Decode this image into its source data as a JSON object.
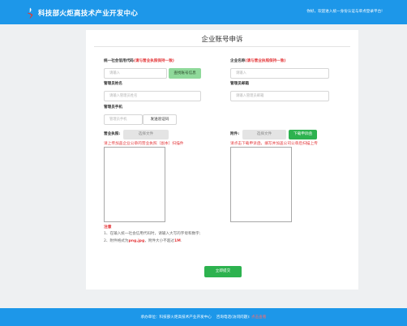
{
  "header": {
    "site_title": "科技部火炬高技术产业开发中心",
    "welcome": "你好，欢迎进入统一身份认证与单点登录平台!",
    "brand_color": "#1d97e9"
  },
  "page_title": "企业账号申诉",
  "form": {
    "credit_code": {
      "label": "统一社会信用代码",
      "req": "(请与营业执照保持一致)",
      "placeholder": "请输入",
      "query_button": "查找账号信息"
    },
    "company_name": {
      "label": "企业名称",
      "req": "(请与营业执照保持一致)",
      "placeholder": "请输入"
    },
    "admin_name": {
      "label": "管理员姓名",
      "placeholder": "请输入管理员姓名"
    },
    "admin_email": {
      "label": "管理员邮箱",
      "placeholder": "请输入管理员邮箱"
    },
    "admin_phone": {
      "label": "管理员手机",
      "placeholder": "管理员手机",
      "code_button": "发送验证码"
    },
    "business_license": {
      "label": "营业执照:",
      "choose_button": "选择文件",
      "hint": "请上传加盖企业公章的营业执照（副本）扫描件"
    },
    "attachment": {
      "label": "附件:",
      "choose_button": "选择文件",
      "download_button": "下载申诉函",
      "hint": "请点击下载申诉函，填写并加盖公司公章后扫描上传"
    }
  },
  "notes": {
    "title": "注意",
    "line1": "1、在输入统一社会信用代码时，请输入大写的字母和数字;",
    "line2_prefix": "2、附件格式为",
    "line2_formats": "png,jpg",
    "line2_middle": "，附件大小不超过",
    "line2_size": "1M",
    "line2_suffix": "."
  },
  "submit_label": "立即提交",
  "footer": {
    "host": "承办单位：科技部火炬高技术产业开发中心",
    "phone_label": "咨询电话",
    "phone_hint": "(访问问题): ",
    "phone_link": "点击查看"
  }
}
